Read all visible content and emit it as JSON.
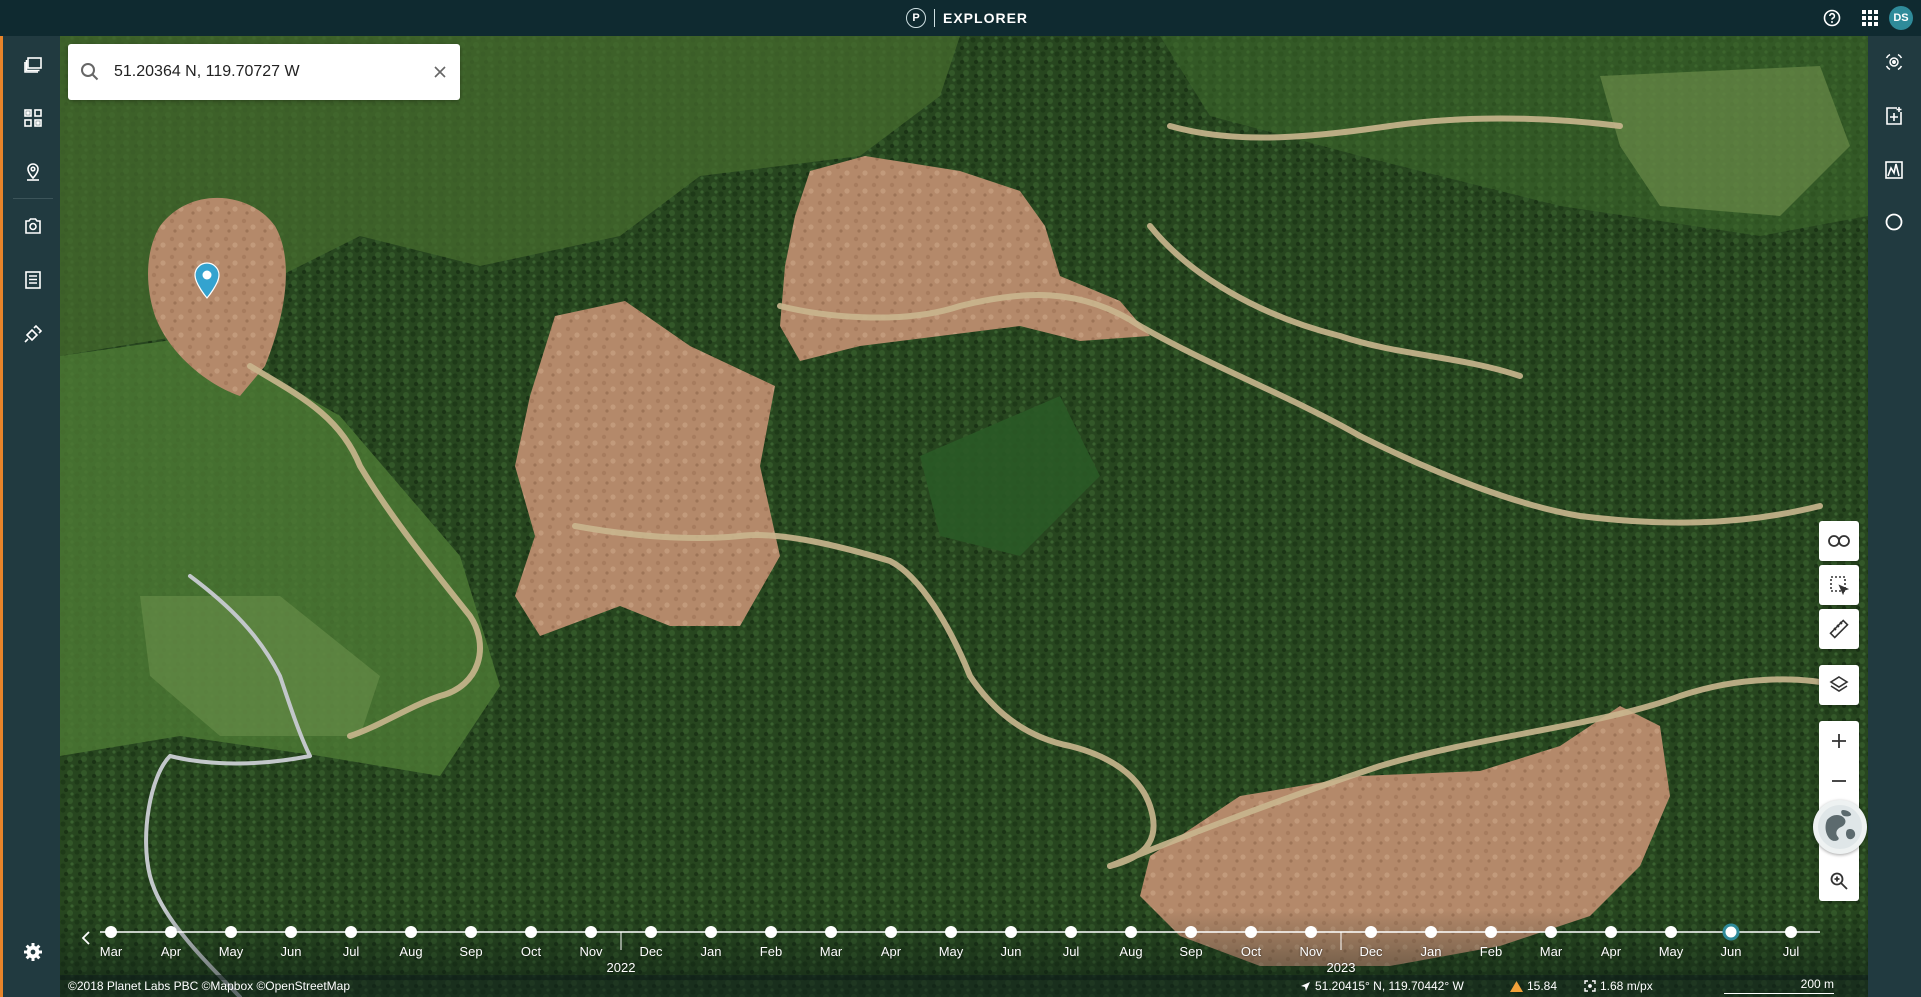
{
  "app": {
    "logo_letter": "P",
    "title": "EXPLORER"
  },
  "user": {
    "initials": "DS"
  },
  "search": {
    "value": "51.20364 N, 119.70727 W",
    "placeholder": ""
  },
  "colors": {
    "topbar": "#0f2a30",
    "rail": "#213a40",
    "accent": "#2f8b9a",
    "marker": "#34a3cf",
    "orange_stripe": "#e8842a"
  },
  "left_rail": {
    "items": [
      "layers-icon",
      "mosaics-icon",
      "places-icon",
      "saved-searches-icon",
      "orders-icon",
      "tasking-icon",
      "settings-icon"
    ]
  },
  "right_rail": {
    "items": [
      "analytics-icon",
      "add-area-icon",
      "elevation-profile-icon",
      "visualization-icon"
    ]
  },
  "map_tools": [
    "share-link-icon",
    "select-area-icon",
    "measure-icon",
    "basemap-layers-icon",
    "zoom-in-icon",
    "zoom-out-icon",
    "globe-icon",
    "zoom-to-icon"
  ],
  "timeline": {
    "months": [
      {
        "label": "Mar",
        "year": "",
        "year_start": false
      },
      {
        "label": "Apr",
        "year": "",
        "year_start": false
      },
      {
        "label": "May",
        "year": "",
        "year_start": false
      },
      {
        "label": "Jun",
        "year": "",
        "year_start": false
      },
      {
        "label": "Jul",
        "year": "",
        "year_start": false
      },
      {
        "label": "Aug",
        "year": "",
        "year_start": false
      },
      {
        "label": "Sep",
        "year": "",
        "year_start": false
      },
      {
        "label": "Oct",
        "year": "",
        "year_start": false
      },
      {
        "label": "Nov",
        "year": "",
        "year_start": false
      },
      {
        "label": "Dec",
        "year": "2022",
        "year_start": true
      },
      {
        "label": "Jan",
        "year": "",
        "year_start": false
      },
      {
        "label": "Feb",
        "year": "",
        "year_start": false
      },
      {
        "label": "Mar",
        "year": "",
        "year_start": false
      },
      {
        "label": "Apr",
        "year": "",
        "year_start": false
      },
      {
        "label": "May",
        "year": "",
        "year_start": false
      },
      {
        "label": "Jun",
        "year": "",
        "year_start": false
      },
      {
        "label": "Jul",
        "year": "",
        "year_start": false
      },
      {
        "label": "Aug",
        "year": "",
        "year_start": false
      },
      {
        "label": "Sep",
        "year": "",
        "year_start": false
      },
      {
        "label": "Oct",
        "year": "",
        "year_start": false
      },
      {
        "label": "Nov",
        "year": "",
        "year_start": false
      },
      {
        "label": "Dec",
        "year": "2023",
        "year_start": true
      },
      {
        "label": "Jan",
        "year": "",
        "year_start": false
      },
      {
        "label": "Feb",
        "year": "",
        "year_start": false
      },
      {
        "label": "Mar",
        "year": "",
        "year_start": false
      },
      {
        "label": "Apr",
        "year": "",
        "year_start": false
      },
      {
        "label": "May",
        "year": "",
        "year_start": false
      },
      {
        "label": "Jun",
        "year": "",
        "year_start": false
      },
      {
        "label": "Jul",
        "year": "",
        "year_start": false
      }
    ],
    "selected_index": 27
  },
  "status": {
    "attribution": "©2018 Planet Labs PBC ©Mapbox ©OpenStreetMap",
    "cursor_coords": "51.20415° N, 119.70442° W",
    "elevation": "15.84",
    "resolution": "1.68 m/px",
    "scale": "200 m"
  }
}
